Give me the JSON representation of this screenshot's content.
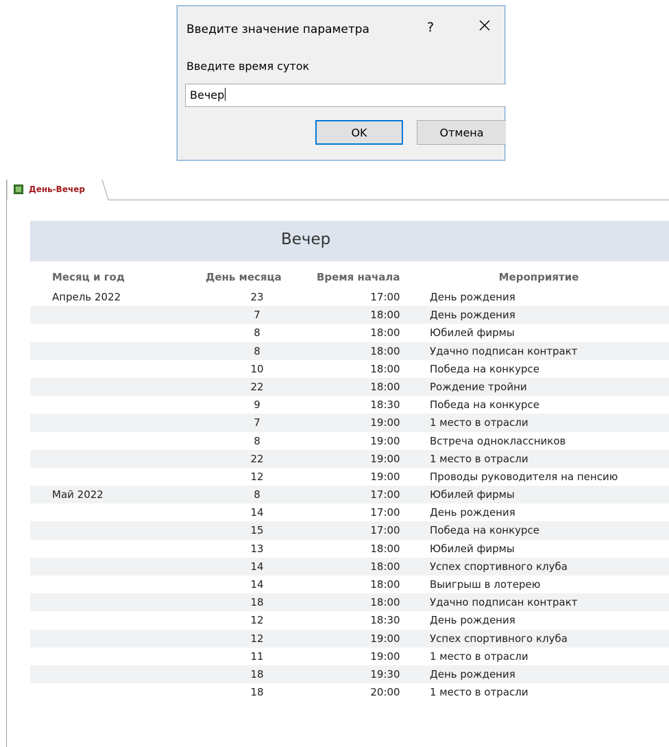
{
  "dialog": {
    "title": "Введите значение параметра",
    "help": "?",
    "prompt": "Введите время суток",
    "input_value": "Вечер",
    "ok_label": "OK",
    "cancel_label": "Отмена"
  },
  "report": {
    "tab_label": "День-Вечер",
    "title": "Вечер",
    "columns": {
      "month": "Месяц и год",
      "day": "День месяца",
      "time": "Время начала",
      "event": "Мероприятие"
    },
    "rows": [
      {
        "month": "Апрель 2022",
        "day": "23",
        "time": "17:00",
        "event": "День рождения"
      },
      {
        "month": "",
        "day": "7",
        "time": "18:00",
        "event": "День рождения"
      },
      {
        "month": "",
        "day": "8",
        "time": "18:00",
        "event": "Юбилей фирмы"
      },
      {
        "month": "",
        "day": "8",
        "time": "18:00",
        "event": "Удачно подписан контракт"
      },
      {
        "month": "",
        "day": "10",
        "time": "18:00",
        "event": "Победа на конкурсе"
      },
      {
        "month": "",
        "day": "22",
        "time": "18:00",
        "event": "Рождение тройни"
      },
      {
        "month": "",
        "day": "9",
        "time": "18:30",
        "event": "Победа на конкурсе"
      },
      {
        "month": "",
        "day": "7",
        "time": "19:00",
        "event": "1 место в отрасли"
      },
      {
        "month": "",
        "day": "8",
        "time": "19:00",
        "event": "Встреча одноклассников"
      },
      {
        "month": "",
        "day": "22",
        "time": "19:00",
        "event": "1 место в отрасли"
      },
      {
        "month": "",
        "day": "12",
        "time": "19:00",
        "event": "Проводы руководителя на пенсию"
      },
      {
        "month": "Май 2022",
        "day": "8",
        "time": "17:00",
        "event": "Юбилей фирмы"
      },
      {
        "month": "",
        "day": "14",
        "time": "17:00",
        "event": "День рождения"
      },
      {
        "month": "",
        "day": "15",
        "time": "17:00",
        "event": "Победа на конкурсе"
      },
      {
        "month": "",
        "day": "13",
        "time": "18:00",
        "event": "Юбилей фирмы"
      },
      {
        "month": "",
        "day": "14",
        "time": "18:00",
        "event": "Успех спортивного клуба"
      },
      {
        "month": "",
        "day": "14",
        "time": "18:00",
        "event": "Выигрыш в лотерею"
      },
      {
        "month": "",
        "day": "18",
        "time": "18:00",
        "event": "Удачно подписан контракт"
      },
      {
        "month": "",
        "day": "12",
        "time": "18:30",
        "event": "День рождения"
      },
      {
        "month": "",
        "day": "12",
        "time": "19:00",
        "event": "Успех спортивного клуба"
      },
      {
        "month": "",
        "day": "11",
        "time": "19:00",
        "event": "1 место в отрасли"
      },
      {
        "month": "",
        "day": "18",
        "time": "19:30",
        "event": "День рождения"
      },
      {
        "month": "",
        "day": "18",
        "time": "20:00",
        "event": "1 место в отрасли"
      }
    ]
  },
  "icons": {
    "close": "close-icon",
    "report": "report-icon"
  },
  "colors": {
    "header_band": "#dde4ee",
    "row_alt": "#f1f2f3",
    "tab_label": "#a01b1b",
    "ok_focus": "#0078d7"
  }
}
